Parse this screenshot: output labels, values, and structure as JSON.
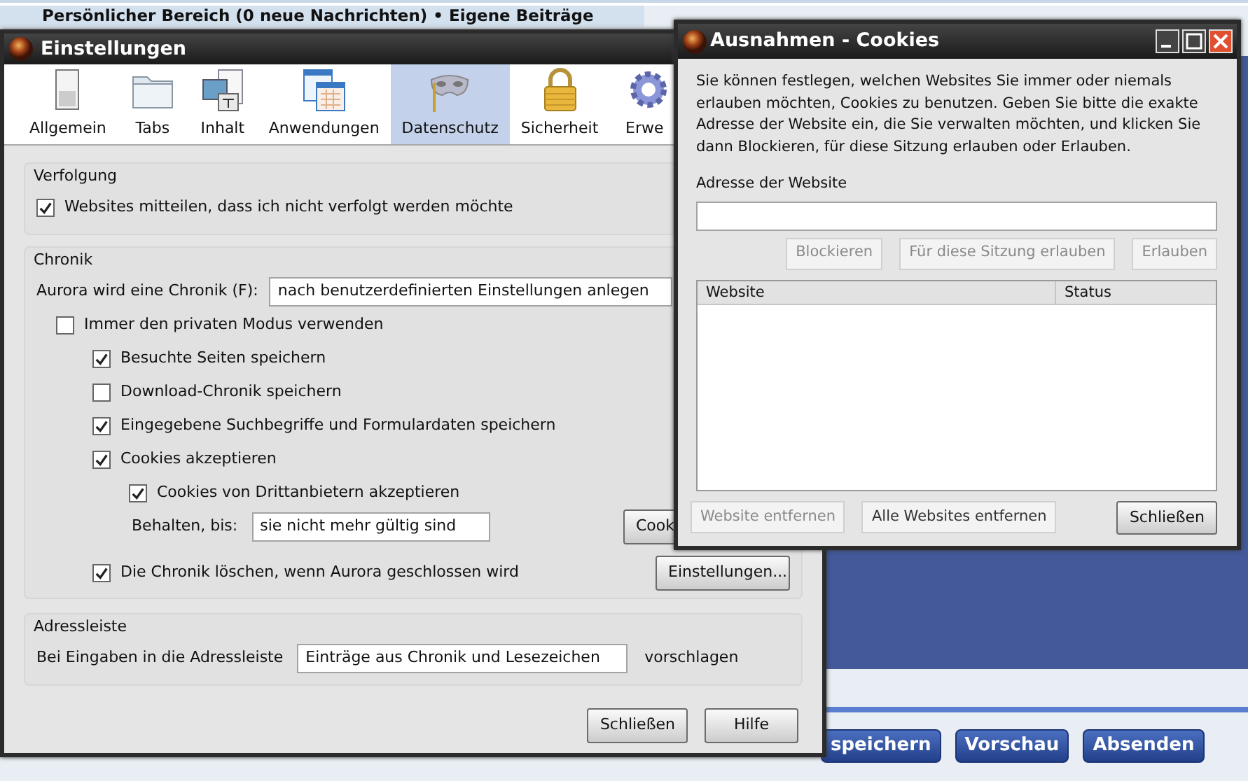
{
  "page": {
    "header": "Persönlicher Bereich (0 neue Nachrichten) • Eigene Beiträge",
    "buttons": [
      "speichern",
      "Vorschau",
      "Absenden"
    ]
  },
  "settings_window": {
    "title": "Einstellungen",
    "tabs": [
      {
        "label": "Allgemein",
        "selected": false
      },
      {
        "label": "Tabs",
        "selected": false
      },
      {
        "label": "Inhalt",
        "selected": false
      },
      {
        "label": "Anwendungen",
        "selected": false
      },
      {
        "label": "Datenschutz",
        "selected": true
      },
      {
        "label": "Sicherheit",
        "selected": false
      },
      {
        "label": "Erwe",
        "selected": false
      }
    ],
    "tracking": {
      "title": "Verfolgung",
      "checkbox": {
        "label": "Websites mitteilen, dass ich nicht verfolgt werden möchte",
        "checked": true
      }
    },
    "history": {
      "title": "Chronik",
      "mode_label": "Aurora wird eine Chronik (F):",
      "mode_value": "nach benutzerdefinierten Einstellungen anlegen",
      "items": [
        {
          "kind": "checkbox",
          "label": "Immer den privaten Modus verwenden",
          "checked": false,
          "children": [
            {
              "kind": "checkbox",
              "label": "Besuchte Seiten speichern",
              "checked": true
            },
            {
              "kind": "checkbox",
              "label": "Download-Chronik speichern",
              "checked": false
            },
            {
              "kind": "checkbox",
              "label": "Eingegebene Suchbegriffe und Formulardaten speichern",
              "checked": true
            },
            {
              "kind": "checkbox",
              "label": "Cookies akzeptieren",
              "checked": true,
              "children": [
                {
                  "kind": "checkbox",
                  "label": "Cookies von Drittanbietern akzeptieren",
                  "checked": true
                },
                {
                  "kind": "select",
                  "label": "Behalten, bis:",
                  "value": "sie nicht mehr gültig sind",
                  "button": "Cook"
                }
              ]
            },
            {
              "kind": "checkbox",
              "label": "Die Chronik löschen, wenn Aurora geschlossen wird",
              "checked": true,
              "button": "Einstellungen..."
            }
          ]
        }
      ]
    },
    "address_bar": {
      "title": "Adressleiste",
      "label": "Bei Eingaben in die Adressleiste",
      "value": "Einträge aus Chronik und Lesezeichen",
      "suffix": "vorschlagen"
    },
    "buttons": [
      "Schließen",
      "Hilfe"
    ]
  },
  "exceptions_window": {
    "title": "Ausnahmen - Cookies",
    "description": "Sie können festlegen, welchen Websites Sie immer oder niemals erlauben möchten, Cookies zu benutzen. Geben Sie bitte die exakte Adresse der Website ein, die Sie verwalten möchten, und klicken Sie dann Blockieren, für diese Sitzung erlauben oder Erlauben.",
    "address_label": "Adresse der Website",
    "action_buttons": [
      {
        "label": "Blockieren",
        "disabled": true
      },
      {
        "label": "Für diese Sitzung erlauben",
        "disabled": true
      },
      {
        "label": "Erlauben",
        "disabled": true
      }
    ],
    "table": {
      "columns": [
        "Website",
        "Status"
      ]
    },
    "bottom_buttons": [
      {
        "label": "Website entfernen",
        "disabled": true
      },
      {
        "label": "Alle Websites entfernen",
        "disabled": false
      }
    ],
    "close_button": "Schließen"
  }
}
